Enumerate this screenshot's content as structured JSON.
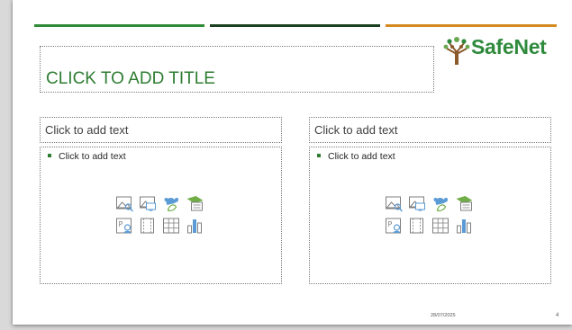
{
  "colors": {
    "bar_green": "#2e8b36",
    "bar_dark_green": "#1b3f1f",
    "bar_orange": "#d48a1e",
    "title_green": "#2e7d32",
    "logo_green": "#2f8a3c",
    "logo_brown": "#8b5a2b",
    "icon_blue": "#5b9bd5",
    "icon_green": "#70ad47"
  },
  "logo": {
    "text": "SafeNet"
  },
  "slide": {
    "title_placeholder": "CLICK TO ADD TITLE",
    "left": {
      "header_placeholder": "Click to add text",
      "body_placeholder": "Click to add text",
      "insert_icons": [
        "insert-picture-icon",
        "insert-screenshot-icon",
        "insert-icons-icon",
        "insert-3d-model-icon",
        "insert-stock-images-icon",
        "insert-video-icon",
        "insert-table-icon",
        "insert-chart-icon"
      ]
    },
    "right": {
      "header_placeholder": "Click to add text",
      "body_placeholder": "Click to add text",
      "insert_icons": [
        "insert-picture-icon",
        "insert-screenshot-icon",
        "insert-icons-icon",
        "insert-3d-model-icon",
        "insert-stock-images-icon",
        "insert-video-icon",
        "insert-table-icon",
        "insert-chart-icon"
      ]
    },
    "footer": {
      "date": "28/07/2025",
      "page_number": "4"
    }
  }
}
